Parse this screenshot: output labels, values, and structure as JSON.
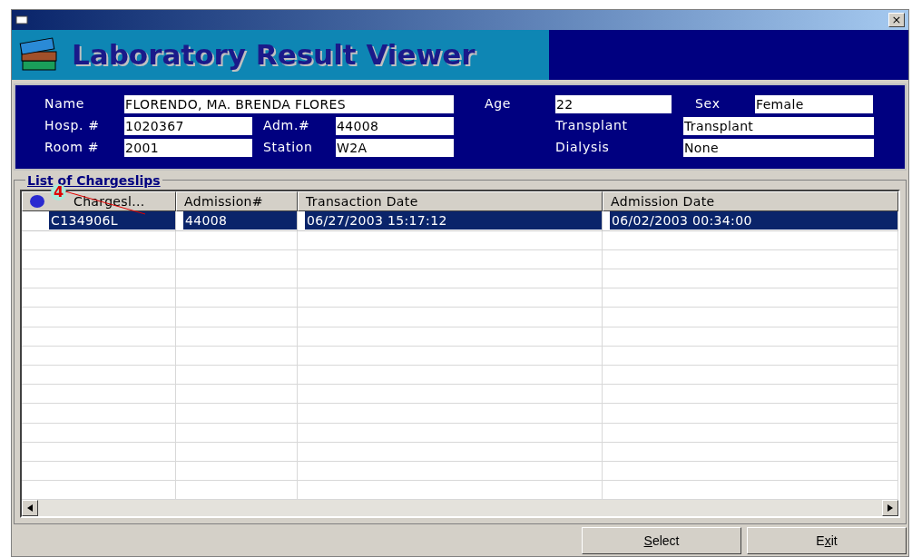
{
  "window": {
    "title_bar_close": "×"
  },
  "banner": {
    "title": "Laboratory Result Viewer"
  },
  "patient": {
    "fields": [
      {
        "label": "Name",
        "value": "FLORENDO, MA. BRENDA FLORES"
      },
      {
        "label": "Age",
        "value": "22"
      },
      {
        "label": "Sex",
        "value": "Female"
      },
      {
        "label": "Hosp. #",
        "value": "1020367"
      },
      {
        "label": "Adm.#",
        "value": "44008"
      },
      {
        "label": "Transplant",
        "value": "Transplant"
      },
      {
        "label": "Room #",
        "value": "2001"
      },
      {
        "label": "Station",
        "value": "W2A"
      },
      {
        "label": "Dialysis",
        "value": "None"
      }
    ]
  },
  "chargeslips": {
    "title": "List of Chargeslips",
    "annotation": "4",
    "columns": [
      "Chargesl...",
      "Admission#",
      "Transaction Date",
      "Admission Date"
    ],
    "rows": [
      {
        "cells": [
          "C134906L",
          "44008",
          "06/27/2003 15:17:12",
          "06/02/2003 00:34:00"
        ],
        "selected": true
      }
    ]
  },
  "buttons": [
    {
      "mnemonic": "S",
      "after": "elect"
    },
    {
      "before": "E",
      "mnemonic": "x",
      "after": "it"
    }
  ]
}
